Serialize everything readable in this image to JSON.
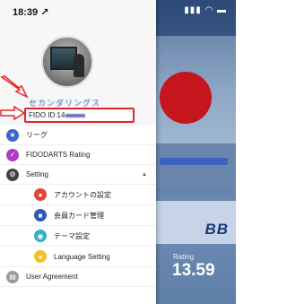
{
  "status_bar": {
    "time": "18:39 ↗"
  },
  "profile": {
    "name_text": "セカンダリングス",
    "fido_prefix": "FIDO ID:14"
  },
  "menu": {
    "items": [
      {
        "label": "リーグ",
        "icon": "star-icon",
        "color": "#3a66d0"
      },
      {
        "label": "FIDODARTS Rating",
        "icon": "rating-icon",
        "color": "#b03ac4"
      },
      {
        "label": "Setting",
        "icon": "gear-icon",
        "color": "#444444"
      },
      {
        "label": "アカウントの設定",
        "icon": "account-icon",
        "color": "#e0463a"
      },
      {
        "label": "会員カード管理",
        "icon": "card-icon",
        "color": "#2f57b8"
      },
      {
        "label": "テーマ設定",
        "icon": "theme-icon",
        "color": "#2eb0c8"
      },
      {
        "label": "Language Setting",
        "icon": "language-icon",
        "color": "#f0c030"
      },
      {
        "label": "User Agreement",
        "icon": "document-icon",
        "color": "#9a9a9a"
      }
    ]
  },
  "background": {
    "bb_text": "BB",
    "rating_label": "Rating",
    "rating_value": "13.59"
  },
  "colors": {
    "highlight_red": "#e52323",
    "accent_blue": "#3a56b8"
  }
}
